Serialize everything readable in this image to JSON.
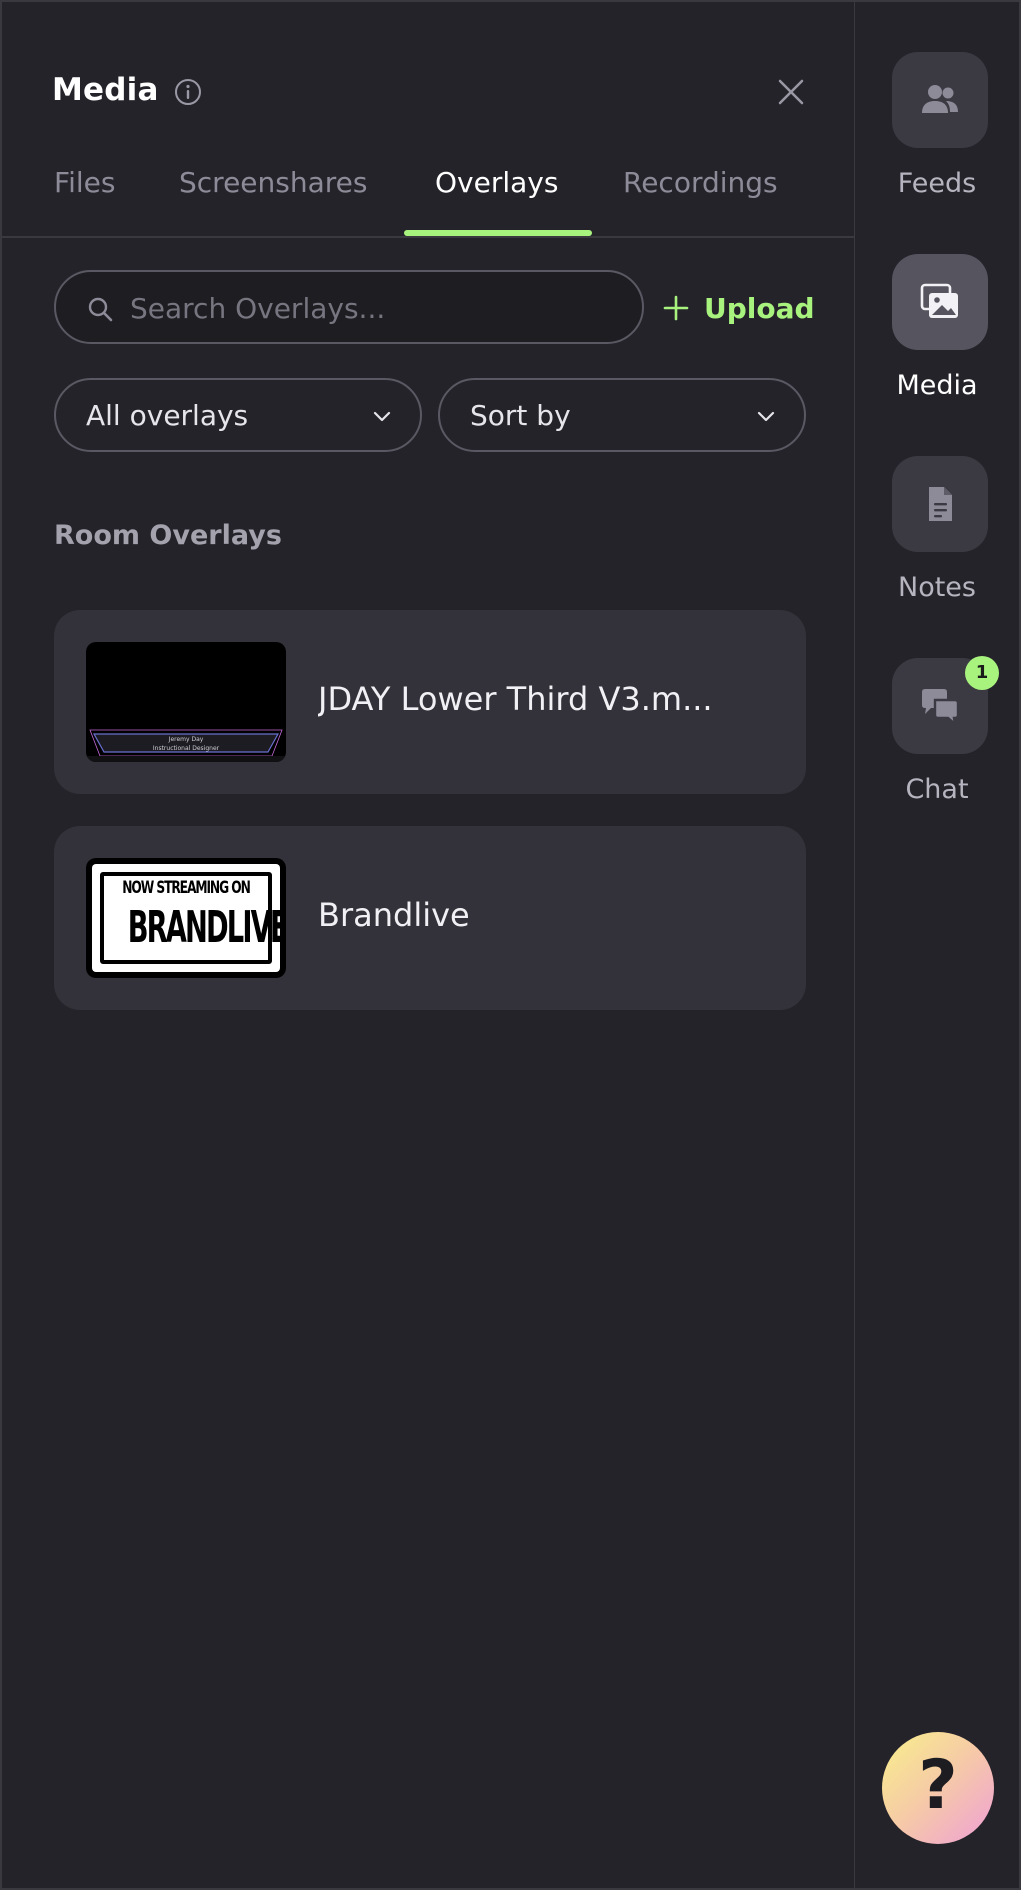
{
  "header": {
    "title": "Media"
  },
  "tabs": [
    {
      "label": "Files",
      "active": false
    },
    {
      "label": "Screenshares",
      "active": false
    },
    {
      "label": "Overlays",
      "active": true
    },
    {
      "label": "Recordings",
      "active": false
    }
  ],
  "search": {
    "placeholder": "Search Overlays...",
    "value": ""
  },
  "toolbar": {
    "upload_label": "Upload"
  },
  "filters": {
    "type_selected": "All overlays",
    "sort_selected": "Sort by"
  },
  "section": {
    "title": "Room Overlays"
  },
  "overlays": [
    {
      "name": "JDAY Lower Third V3.m...",
      "thumb_line1": "Jeremy Day",
      "thumb_line2": "Instructional Designer"
    },
    {
      "name": "Brandlive",
      "thumb_line1": "NOW STREAMING ON",
      "thumb_line2": "BRANDLIVE"
    }
  ],
  "rail": [
    {
      "label": "Feeds",
      "icon": "users-icon",
      "active": false
    },
    {
      "label": "Media",
      "icon": "image-icon",
      "active": true
    },
    {
      "label": "Notes",
      "icon": "document-icon",
      "active": false
    },
    {
      "label": "Chat",
      "icon": "chat-icon",
      "active": false,
      "badge": "1"
    }
  ],
  "help": {
    "glyph": "?"
  },
  "colors": {
    "background": "#25232a",
    "accent": "#a8f37e",
    "card": "#333139"
  }
}
